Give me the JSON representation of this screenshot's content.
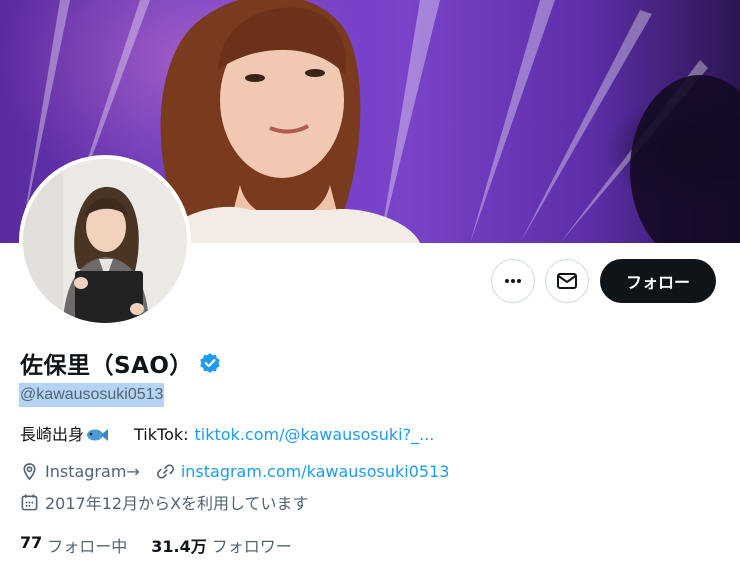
{
  "profile": {
    "display_name": "佐保里（SAO）",
    "handle": "@kawausosuki0513",
    "bio_origin": "長崎出身",
    "bio_tiktok_label": "TikTok:",
    "bio_tiktok_link": "tiktok.com/@kawausosuki?_...",
    "location": "Instagram→",
    "website": "instagram.com/kawausosuki0513",
    "joined": "2017年12月からXを利用しています",
    "following_count": "77",
    "following_label": "フォロー中",
    "followers_count": "31.4万",
    "followers_label": "フォロワー"
  },
  "actions": {
    "follow_label": "フォロー"
  },
  "icons": {
    "more": "more-dots-icon",
    "message": "envelope-icon",
    "verified": "verified-badge-icon",
    "fish": "fish-emoji-icon",
    "location": "location-pin-icon",
    "link": "link-icon",
    "calendar": "calendar-icon"
  },
  "colors": {
    "accent": "#1d9bf0",
    "follow_button": "#0f1419",
    "muted_text": "#536471",
    "handle_highlight": "#b4d3f5"
  }
}
